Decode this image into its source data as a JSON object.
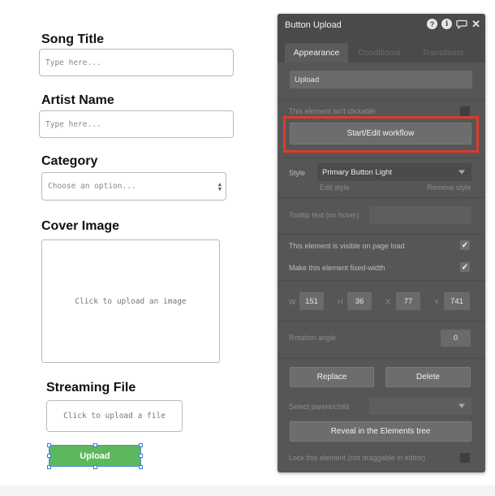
{
  "form": {
    "song_title_label": "Song Title",
    "song_title_placeholder": "Type here...",
    "artist_name_label": "Artist Name",
    "artist_name_placeholder": "Type here...",
    "category_label": "Category",
    "category_placeholder": "Choose an option...",
    "cover_image_label": "Cover Image",
    "cover_image_prompt": "Click to upload an image",
    "streaming_file_label": "Streaming File",
    "streaming_file_prompt": "Click to upload a file",
    "upload_button_label": "Upload"
  },
  "panel": {
    "title": "Button Upload",
    "icons": [
      "help-icon",
      "info-icon",
      "comment-icon",
      "close-icon"
    ],
    "help_glyph": "?",
    "info_glyph": "i",
    "close_glyph": "✕",
    "tabs": [
      "Appearance",
      "Conditional",
      "Transitions"
    ],
    "active_tab": "Appearance",
    "button_text_value": "Upload",
    "not_clickable_label": "This element isn't clickable",
    "not_clickable_checked": false,
    "workflow_button": "Start/Edit workflow",
    "style_label": "Style",
    "style_value": "Primary Button Light",
    "edit_style": "Edit style",
    "remove_style": "Remove style",
    "tooltip_label": "Tooltip text (on hover)",
    "tooltip_value": "",
    "visible_on_load_label": "This element is visible on page load",
    "visible_on_load_checked": true,
    "fixed_width_label": "Make this element fixed-width",
    "fixed_width_checked": true,
    "check_glyph": "✓",
    "dims": {
      "w_label": "W",
      "w": "151",
      "h_label": "H",
      "h": "36",
      "x_label": "X",
      "x": "77",
      "y_label": "Y",
      "y": "741"
    },
    "rotation_label": "Rotation angle",
    "rotation_value": "0",
    "replace_button": "Replace",
    "delete_button": "Delete",
    "parent_child_label": "Select parent/child",
    "reveal_button": "Reveal in the Elements tree",
    "lock_label": "Lock this element (not draggable in editor)",
    "lock_checked": false
  },
  "colors": {
    "upload_button": "#5cb85c",
    "panel_bg": "#565656",
    "highlight": "#e03a2c",
    "selection": "#3b7dd8"
  }
}
